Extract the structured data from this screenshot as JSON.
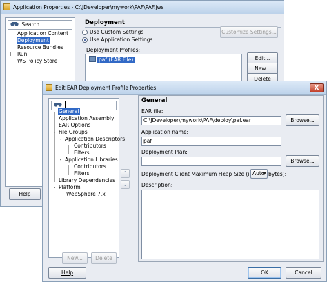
{
  "back_window": {
    "title": "Application Properties - C:\\JDeveloper\\mywork\\PAF\\PAF.jws",
    "search_placeholder": "Search",
    "nav_items": [
      {
        "label": "Application Content",
        "expander": ""
      },
      {
        "label": "Deployment",
        "expander": ""
      },
      {
        "label": "Resource Bundles",
        "expander": ""
      },
      {
        "label": "Run",
        "expander": "+"
      },
      {
        "label": "WS Policy Store",
        "expander": ""
      }
    ],
    "section_title": "Deployment",
    "radio_custom": "Use Custom Settings",
    "radio_app": "Use Application Settings",
    "customize_button": "Customize Settings...",
    "profiles_label": "Deployment Profiles:",
    "profile_item": "paf (EAR File)",
    "edit_button": "Edit...",
    "new_button": "New...",
    "delete_button": "Delete",
    "help_button": "Help"
  },
  "front_window": {
    "title": "Edit EAR Deployment Profile Properties",
    "close_glyph": "X",
    "tree": [
      {
        "label": "General",
        "indent": 0,
        "expander": "",
        "selected": true
      },
      {
        "label": "Application Assembly",
        "indent": 0,
        "expander": ""
      },
      {
        "label": "EAR Options",
        "indent": 0,
        "expander": ""
      },
      {
        "label": "File Groups",
        "indent": 0,
        "expander": "-"
      },
      {
        "label": "Application Descriptors",
        "indent": 1,
        "expander": "-"
      },
      {
        "label": "Contributors",
        "indent": 2,
        "expander": ""
      },
      {
        "label": "Filters",
        "indent": 2,
        "expander": ""
      },
      {
        "label": "Application Libraries",
        "indent": 1,
        "expander": "-"
      },
      {
        "label": "Contributors",
        "indent": 2,
        "expander": ""
      },
      {
        "label": "Filters",
        "indent": 2,
        "expander": ""
      },
      {
        "label": "Library Dependencies",
        "indent": 0,
        "expander": ""
      },
      {
        "label": "Platform",
        "indent": 0,
        "expander": "-"
      },
      {
        "label": "WebSphere 7.x",
        "indent": 1,
        "expander": ""
      }
    ],
    "new_button": "New...",
    "delete_button": "Delete",
    "section_title": "General",
    "ear_file_label": "EAR file:",
    "ear_file_value": "C:\\JDeveloper\\mywork\\PAF\\deploy\\paf.ear",
    "browse1": "Browse...",
    "app_name_label": "Application name:",
    "app_name_value": "paf",
    "deploy_plan_label": "Deployment Plan:",
    "deploy_plan_value": "",
    "browse2": "Browse...",
    "heap_label": "Deployment Client Maximum Heap Size (in Megabytes):",
    "heap_value": "Auto",
    "description_label": "Description:",
    "description_value": "",
    "help_button": "Help",
    "ok_button": "OK",
    "cancel_button": "Cancel"
  }
}
